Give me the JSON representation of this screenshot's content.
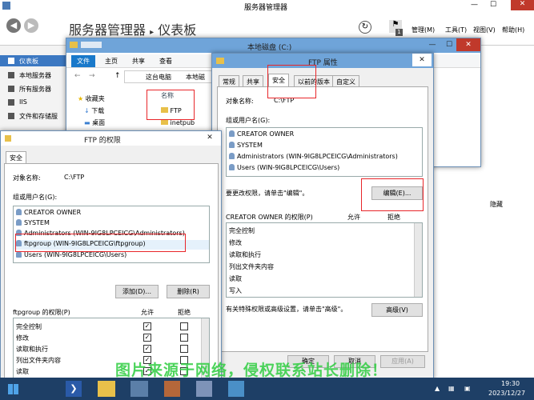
{
  "server_manager": {
    "window_title": "服务器管理器",
    "breadcrumb_app": "服务器管理器",
    "breadcrumb_sep": "▸",
    "breadcrumb_page": "仪表板",
    "menu": [
      "管理(M)",
      "工具(T)",
      "视图(V)",
      "帮助(H)"
    ],
    "notification_count": "1",
    "sidebar": [
      "仪表板",
      "本地服务器",
      "所有服务器",
      "IIS",
      "文件和存储服"
    ],
    "hide_label": "隐藏"
  },
  "explorer": {
    "title": "本地磁盘 (C:)",
    "ribbon_tabs": [
      "文件",
      "主页",
      "共享",
      "查看"
    ],
    "path": [
      "这台电脑",
      "本地磁"
    ],
    "nav_items": [
      "收藏夹",
      "下载",
      "桌面"
    ],
    "col_name": "名称",
    "files": [
      "FTP",
      "inetpub"
    ]
  },
  "ftp_props": {
    "title": "FTP 属性",
    "tabs": [
      "常规",
      "共享",
      "安全",
      "以前的版本",
      "自定义"
    ],
    "object_label": "对象名称:",
    "object_value": "C:\\FTP",
    "group_label": "组或用户名(G):",
    "users": [
      "CREATOR OWNER",
      "SYSTEM",
      "Administrators (WIN-9IG8LPCEICG\\Administrators)",
      "Users (WIN-9IG8LPCEICG\\Users)"
    ],
    "change_hint": "要更改权限，请单击\"编辑\"。",
    "edit_btn": "编辑(E)...",
    "perm_title": "CREATOR OWNER 的权限(P)",
    "allow": "允许",
    "deny": "拒绝",
    "perms": [
      "完全控制",
      "修改",
      "读取和执行",
      "列出文件夹内容",
      "读取",
      "写入"
    ],
    "advanced_hint": "有关特殊权限或高级设置，请单击\"高级\"。",
    "advanced_btn": "高级(V)",
    "ok": "确定",
    "cancel": "取消",
    "apply": "应用(A)"
  },
  "ftp_perm": {
    "title": "FTP 的权限",
    "tab": "安全",
    "object_label": "对象名称:",
    "object_value": "C:\\FTP",
    "group_label": "组或用户名(G):",
    "users": [
      "CREATOR OWNER",
      "SYSTEM",
      "Administrators (WIN-9IG8LPCEICG\\Administrators)",
      "ftpgroup (WIN-9IG8LPCEICG\\ftpgroup)",
      "Users (WIN-9IG8LPCEICG\\Users)"
    ],
    "add_btn": "添加(D)...",
    "remove_btn": "删除(R)",
    "perm_title": "ftpgroup 的权限(P)",
    "allow": "允许",
    "deny": "拒绝",
    "perms": [
      "完全控制",
      "修改",
      "读取和执行",
      "列出文件夹内容",
      "读取"
    ],
    "allowed": [
      true,
      true,
      true,
      true,
      true
    ],
    "denied": [
      false,
      false,
      false,
      false,
      false
    ]
  },
  "taskbar": {
    "time": "19:30",
    "date": "2023/12/27"
  },
  "watermark": "图片来源于网络，侵权联系站长删除！",
  "colors": {
    "accent": "#e8262a",
    "watermark": "#2ecc40",
    "titlebar": "#6fa4d9",
    "taskbar": "#1e3f66"
  }
}
